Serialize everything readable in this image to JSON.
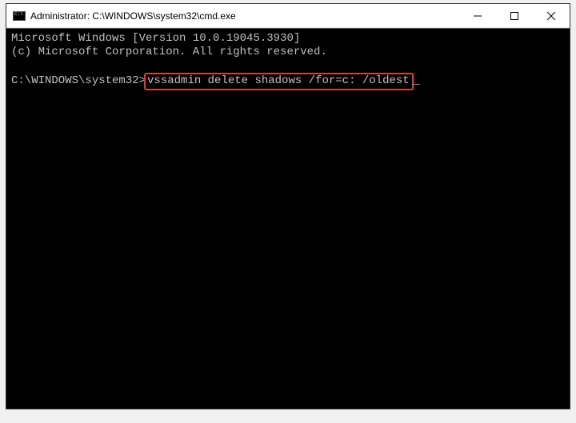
{
  "window": {
    "title": "Administrator: C:\\WINDOWS\\system32\\cmd.exe"
  },
  "terminal": {
    "line1": "Microsoft Windows [Version 10.0.19045.3930]",
    "line2": "(c) Microsoft Corporation. All rights reserved.",
    "prompt": "C:\\WINDOWS\\system32>",
    "command": "vssadmin delete shadows /for=c: /oldest",
    "cursor": "_"
  },
  "icons": {
    "minimize": "minimize-icon",
    "maximize": "maximize-icon",
    "close": "close-icon",
    "app": "cmd-icon"
  }
}
